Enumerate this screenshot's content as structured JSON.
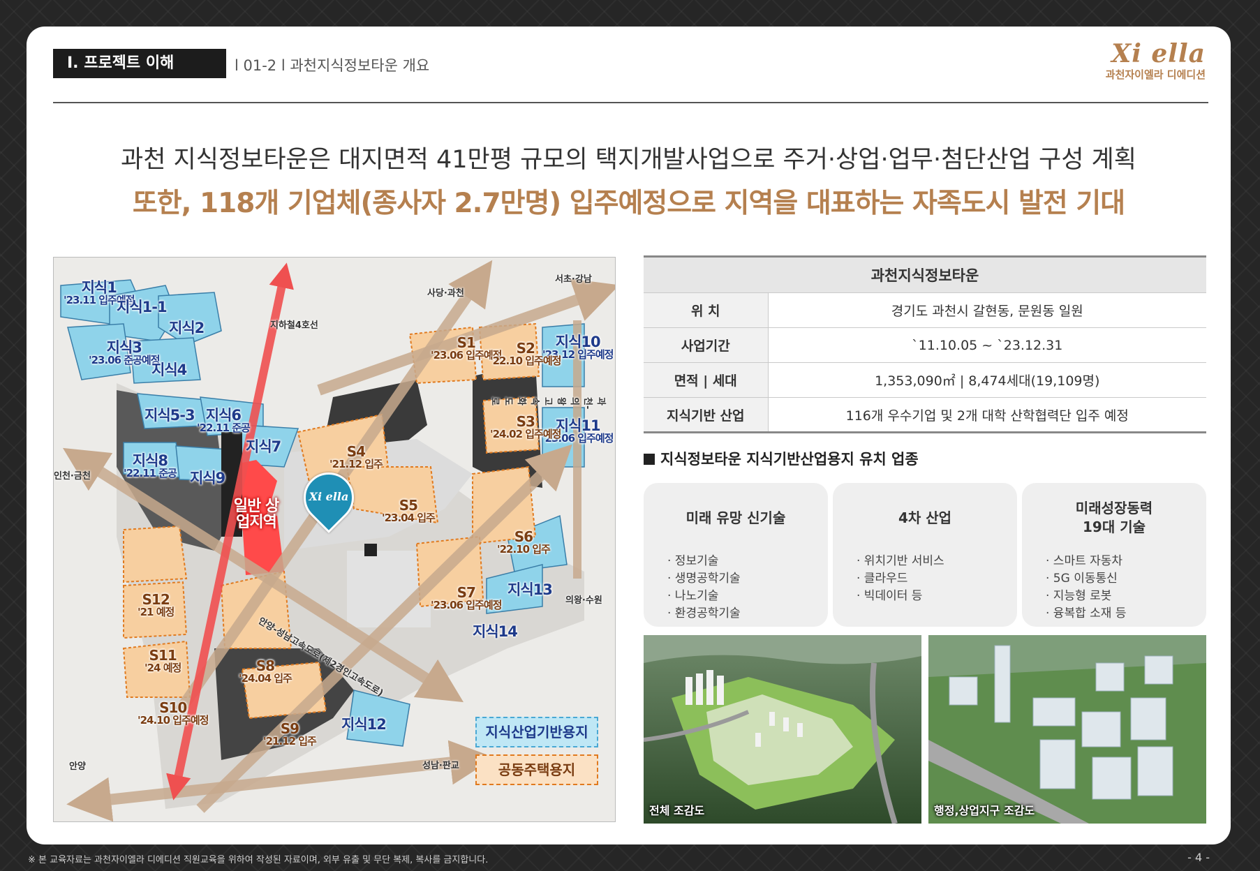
{
  "header": {
    "section_tag": "Ⅰ. 프로젝트 이해",
    "section_sub": "l 01-2 l 과천지식정보타운 개요",
    "logo_mark": "Xi ella",
    "logo_sub": "과천자이엘라 디에디션"
  },
  "headline": {
    "line1": "과천 지식정보타운은 대지면적 41만평 규모의 택지개발사업으로 주거·상업·업무·첨단산업 구성 계획",
    "line2": "또한, 118개 기업체(종사자 2.7만명) 입주예정으로 지역을 대표하는 자족도시 발전 기대"
  },
  "map": {
    "blue_plots": [
      {
        "name": "지식1",
        "note": "'23.11 입주예정"
      },
      {
        "name": "지식1-1",
        "note": ""
      },
      {
        "name": "지식2",
        "note": ""
      },
      {
        "name": "지식3",
        "note": "'23.06 준공예정"
      },
      {
        "name": "지식4",
        "note": ""
      },
      {
        "name": "지식5-3",
        "note": ""
      },
      {
        "name": "지식6",
        "note": "'22.11 준공"
      },
      {
        "name": "지식7",
        "note": ""
      },
      {
        "name": "지식8",
        "note": "'22.11 준공"
      },
      {
        "name": "지식9",
        "note": ""
      },
      {
        "name": "지식10",
        "note": "'23.12 입주예정"
      },
      {
        "name": "지식11",
        "note": "'23.06 입주예정"
      },
      {
        "name": "지식12",
        "note": ""
      },
      {
        "name": "지식13",
        "note": ""
      },
      {
        "name": "지식14",
        "note": ""
      }
    ],
    "orange_plots": [
      {
        "name": "S1",
        "note": "'23.06 입주예정"
      },
      {
        "name": "S2",
        "note": "'22.10 입주예정"
      },
      {
        "name": "S3",
        "note": "'24.02 입주예정"
      },
      {
        "name": "S4",
        "note": "'21.12 입주"
      },
      {
        "name": "S5",
        "note": "'23.04 입주"
      },
      {
        "name": "S6",
        "note": "'22.10 입주"
      },
      {
        "name": "S7",
        "note": "'23.06 입주예정"
      },
      {
        "name": "S8",
        "note": "'24.04 입주"
      },
      {
        "name": "S9",
        "note": "'21.12 입주"
      },
      {
        "name": "S10",
        "note": "'24.10 입주예정"
      },
      {
        "name": "S11",
        "note": "'24 예정"
      },
      {
        "name": "S12",
        "note": "'21 예정"
      }
    ],
    "commercial": "일반 상업지역",
    "pin_logo": "Xi ella",
    "roads": {
      "subway": "지하철4호선",
      "sadang": "사당·과천",
      "seocho": "서초·강남",
      "incheon": "인천·금천",
      "uiwang": "의왕·수원",
      "anyang": "안양",
      "seongnam": "성남·판교",
      "expressway1": "안양-성남고속도로(제2경인고속도로)",
      "expressway2": "과천-의왕고속화도로"
    },
    "legend": {
      "blue": "지식산업기반용지",
      "orange": "공동주택용지"
    },
    "colors": {
      "blue_plot": "#8fd3ea",
      "orange_plot": "#f7cfa0",
      "commercial": "#ff3b3b",
      "arrow": "#c7a98d"
    }
  },
  "table": {
    "title": "과천지식정보타운",
    "rows": [
      {
        "key": "위  치",
        "value": "경기도 과천시 갈현동, 문원동 일원"
      },
      {
        "key": "사업기간",
        "value": "`11.10.05 ~ `23.12.31"
      },
      {
        "key": "면적 | 세대",
        "value": "1,353,090㎡ | 8,474세대(19,109명)"
      },
      {
        "key": "지식기반 산업",
        "value": "116개 우수기업 및 2개 대학 산학협력단 입주 예정"
      }
    ]
  },
  "industries": {
    "title": "지식정보타운 지식기반산업용지 유치 업종",
    "cards": [
      {
        "title": "미래 유망 신기술",
        "items": [
          "· 정보기술",
          "· 생명공학기술",
          "· 나노기술",
          "· 환경공학기술"
        ]
      },
      {
        "title": "4차 산업",
        "items": [
          "· 위치기반 서비스",
          "· 클라우드",
          "· 빅데이터 등"
        ]
      },
      {
        "title": "미래성장동력\n19대 기술",
        "items": [
          "· 스마트 자동차",
          "· 5G 이동통신",
          "· 지능형 로봇",
          "· 융복합 소재 등"
        ]
      }
    ]
  },
  "photos": [
    {
      "caption": "전체 조감도"
    },
    {
      "caption": "행정,상업지구 조감도"
    }
  ],
  "footer": {
    "note": "※ 본 교육자료는 과천자이엘라 디에디션 직원교육을 위하여 작성된 자료이며, 외부 유출 및 무단 복제, 복사를 금지합니다.",
    "page": "- 4 -"
  }
}
